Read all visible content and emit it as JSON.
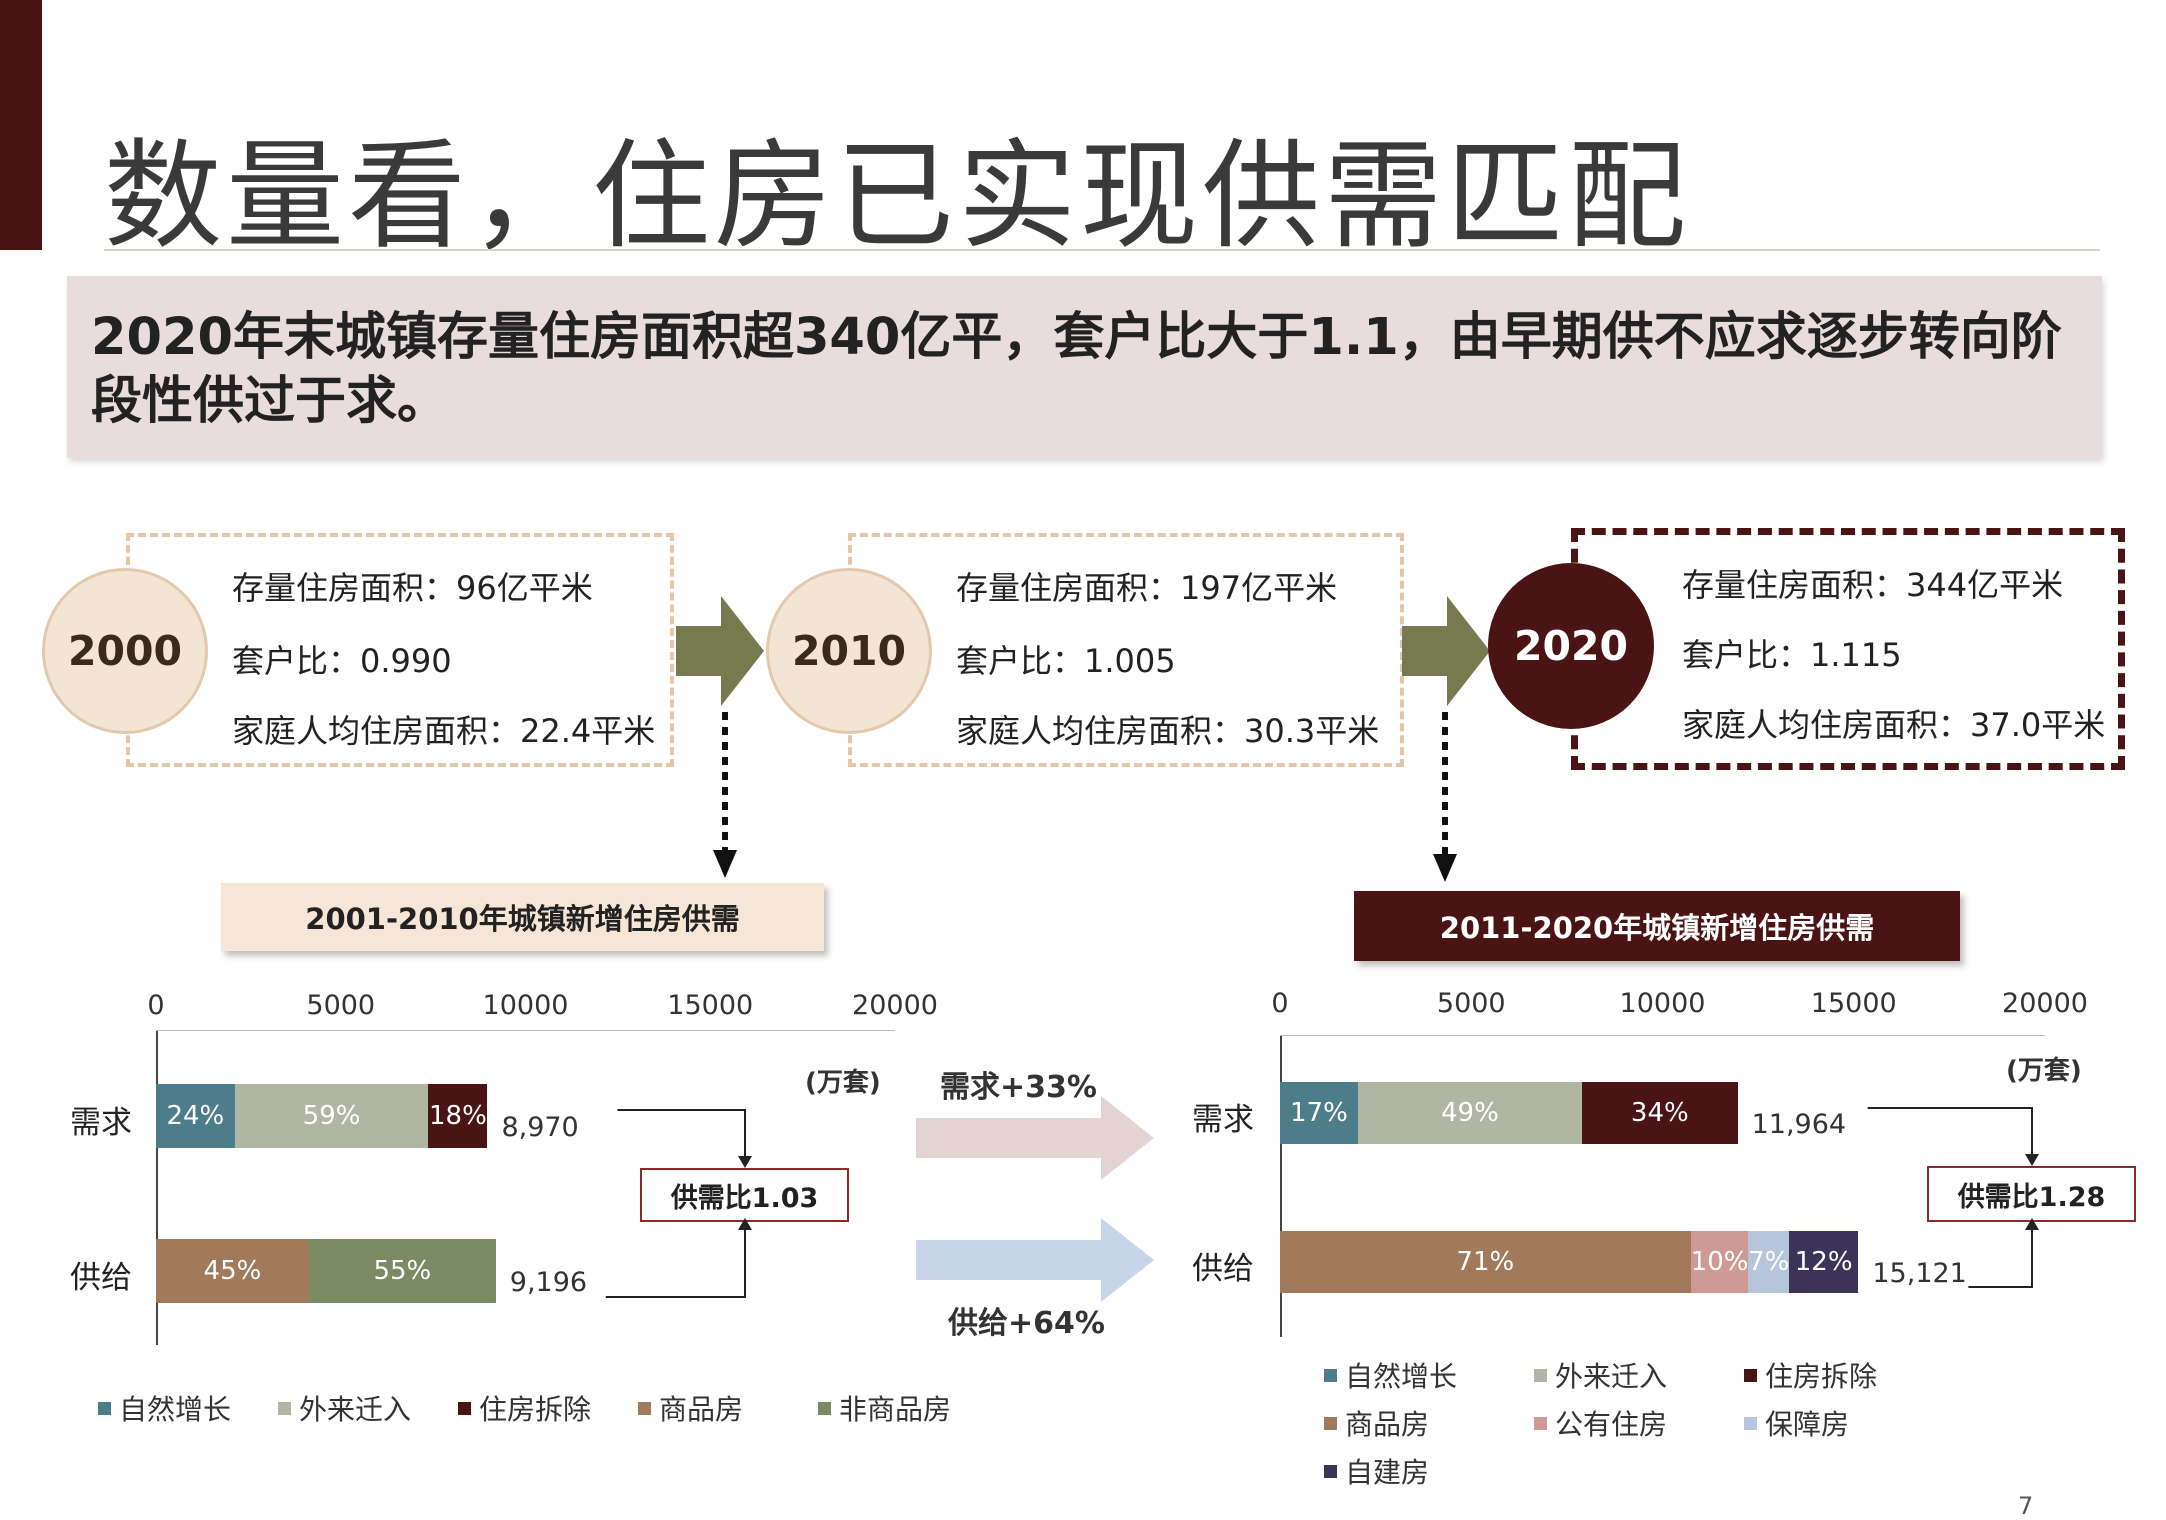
{
  "title": "数量看，住房已实现供需匹配",
  "summary": "2020年末城镇存量住房面积超340亿平，套户比大于1.1，由早期供不应求逐步转向阶段性供过于求。",
  "milestones": [
    {
      "year": "2000",
      "stock": "存量住房面积：96亿平米",
      "ratio": "套户比：0.990",
      "area": "家庭人均住房面积：22.4平米"
    },
    {
      "year": "2010",
      "stock": "存量住房面积：197亿平米",
      "ratio": "套户比：1.005",
      "area": "家庭人均住房面积：30.3平米"
    },
    {
      "year": "2020",
      "stock": "存量住房面积：344亿平米",
      "ratio": "套户比：1.115",
      "area": "家庭人均住房面积：37.0平米"
    }
  ],
  "banners": {
    "left": "2001-2010年城镇新增住房供需",
    "right": "2011-2020年城镇新增住房供需"
  },
  "arrows": {
    "demand_change": "需求+33%",
    "supply_change": "供给+64%"
  },
  "colors": {
    "natural": "#4d7c8a",
    "migration": "#b1b6a4",
    "demolition": "#4a1414",
    "commercial": "#a07a5a",
    "noncommercial": "#7a8a62",
    "public": "#cf9a95",
    "affordable": "#b6c4dc",
    "selfbuilt": "#3b3458"
  },
  "chart_data": [
    {
      "type": "bar",
      "orientation": "horizontal",
      "stacked": true,
      "unit": "(万套)",
      "xlim": [
        0,
        20000
      ],
      "xticks": [
        "0",
        "5000",
        "10000",
        "15000",
        "20000"
      ],
      "categories": [
        "需求",
        "供给"
      ],
      "totals": [
        8970,
        9196
      ],
      "total_labels": [
        "8,970",
        "9,196"
      ],
      "ratio_label": "供需比1.03",
      "rows": [
        {
          "category": "需求",
          "segments": [
            {
              "name": "自然增长",
              "share": 24,
              "label": "24%",
              "color": "natural"
            },
            {
              "name": "外来迁入",
              "share": 59,
              "label": "59%",
              "color": "migration"
            },
            {
              "name": "住房拆除",
              "share": 18,
              "label": "18%",
              "color": "demolition"
            }
          ]
        },
        {
          "category": "供给",
          "segments": [
            {
              "name": "商品房",
              "share": 45,
              "label": "45%",
              "color": "commercial"
            },
            {
              "name": "非商品房",
              "share": 55,
              "label": "55%",
              "color": "noncommercial"
            }
          ]
        }
      ],
      "legend": [
        {
          "label": "自然增长",
          "color": "natural"
        },
        {
          "label": "外来迁入",
          "color": "migration"
        },
        {
          "label": "住房拆除",
          "color": "demolition"
        },
        {
          "label": "商品房",
          "color": "commercial"
        },
        {
          "label": "非商品房",
          "color": "noncommercial"
        }
      ]
    },
    {
      "type": "bar",
      "orientation": "horizontal",
      "stacked": true,
      "unit": "(万套)",
      "xlim": [
        0,
        20000
      ],
      "xticks": [
        "0",
        "5000",
        "10000",
        "15000",
        "20000"
      ],
      "categories": [
        "需求",
        "供给"
      ],
      "totals": [
        11964,
        15121
      ],
      "total_labels": [
        "11,964",
        "15,121"
      ],
      "ratio_label": "供需比1.28",
      "rows": [
        {
          "category": "需求",
          "segments": [
            {
              "name": "自然增长",
              "share": 17,
              "label": "17%",
              "color": "natural"
            },
            {
              "name": "外来迁入",
              "share": 49,
              "label": "49%",
              "color": "migration"
            },
            {
              "name": "住房拆除",
              "share": 34,
              "label": "34%",
              "color": "demolition"
            }
          ]
        },
        {
          "category": "供给",
          "segments": [
            {
              "name": "商品房",
              "share": 71,
              "label": "71%",
              "color": "commercial"
            },
            {
              "name": "公有住房",
              "share": 10,
              "label": "10%",
              "color": "public"
            },
            {
              "name": "保障房",
              "share": 7,
              "label": "7%",
              "color": "affordable"
            },
            {
              "name": "自建房",
              "share": 12,
              "label": "12%",
              "color": "selfbuilt"
            }
          ]
        }
      ],
      "legend": [
        {
          "label": "自然增长",
          "color": "natural"
        },
        {
          "label": "外来迁入",
          "color": "migration"
        },
        {
          "label": "住房拆除",
          "color": "demolition"
        },
        {
          "label": "商品房",
          "color": "commercial"
        },
        {
          "label": "公有住房",
          "color": "public"
        },
        {
          "label": "保障房",
          "color": "affordable"
        },
        {
          "label": "自建房",
          "color": "selfbuilt"
        }
      ]
    }
  ],
  "page_number": "7"
}
